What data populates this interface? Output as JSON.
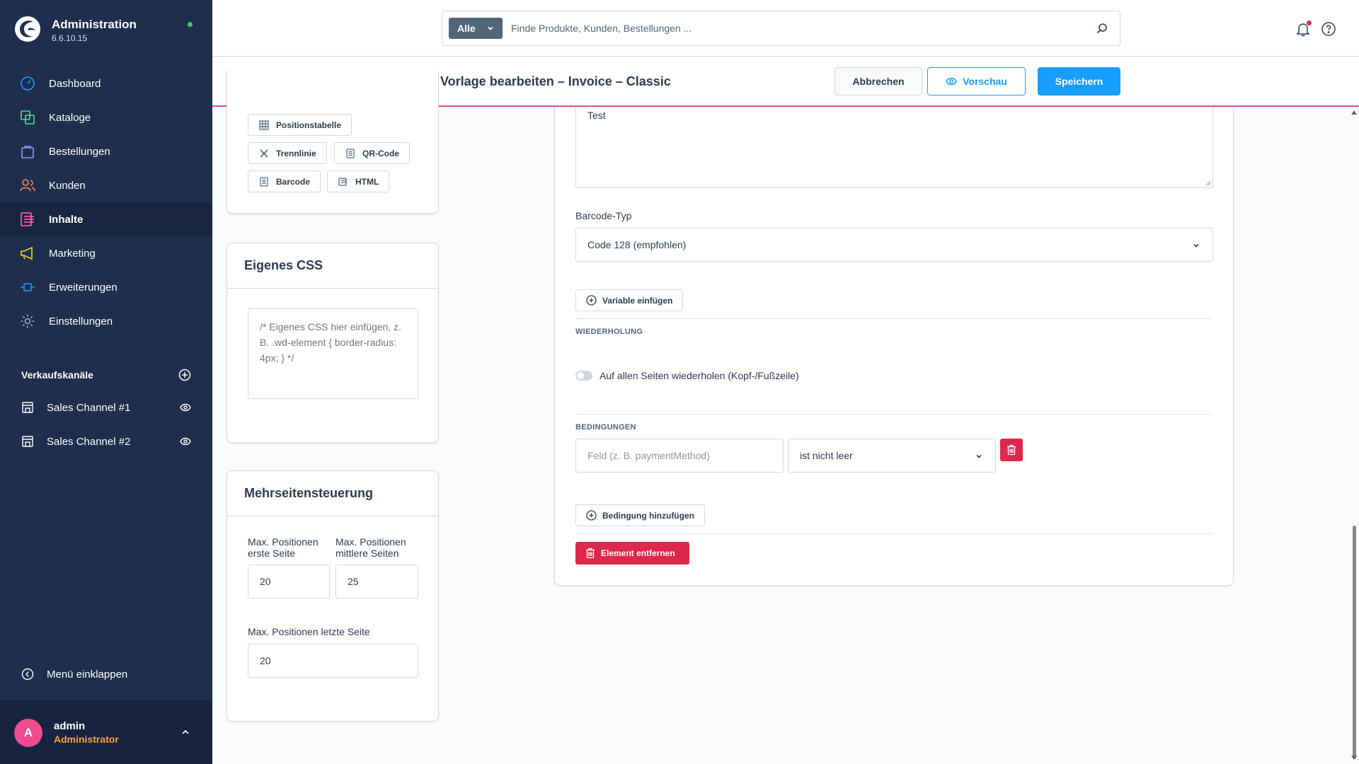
{
  "brand": {
    "title": "Administration",
    "version": "6.6.10.15"
  },
  "nav": [
    {
      "label": "Dashboard",
      "icon": "gauge-icon",
      "color": "#189eff"
    },
    {
      "label": "Kataloge",
      "icon": "products-icon",
      "color": "#57d9a3"
    },
    {
      "label": "Bestellungen",
      "icon": "shopping-bag-icon",
      "color": "#a092f0"
    },
    {
      "label": "Kunden",
      "icon": "users-icon",
      "color": "#f88962"
    },
    {
      "label": "Inhalte",
      "icon": "content-icon",
      "color": "#ff68b4"
    },
    {
      "label": "Marketing",
      "icon": "megaphone-icon",
      "color": "#ffd700"
    },
    {
      "label": "Erweiterungen",
      "icon": "plug-icon",
      "color": "#189eff"
    },
    {
      "label": "Einstellungen",
      "icon": "gear-icon",
      "color": "#9aa8b5"
    }
  ],
  "channels": {
    "heading": "Verkaufskanäle",
    "items": [
      {
        "label": "Sales Channel #1"
      },
      {
        "label": "Sales Channel #2"
      }
    ]
  },
  "collapse_label": "Menü einklappen",
  "user": {
    "initial": "A",
    "name": "admin",
    "role": "Administrator"
  },
  "search": {
    "scope": "Alle",
    "placeholder": "Finde Produkte, Kunden, Bestellungen ..."
  },
  "smartbar": {
    "title": "Vorlage bearbeiten – Invoice – Classic",
    "cancel": "Abbrechen",
    "preview": "Vorschau",
    "save": "Speichern"
  },
  "elements_card": {
    "chips": [
      "Positionstabelle",
      "Trennlinie",
      "QR-Code",
      "Barcode",
      "HTML"
    ]
  },
  "css_card": {
    "title": "Eigenes CSS",
    "placeholder": "/* Eigenes CSS hier einfügen, z. B. .wd-element { border-radius: 4px; } */"
  },
  "multipage_card": {
    "title": "Mehrseitensteuerung",
    "first_label_1": "Max. Positionen",
    "first_label_2": "erste Seite",
    "first_value": "20",
    "middle_label_1": "Max. Positionen",
    "middle_label_2": "mittlere Seiten",
    "middle_value": "25",
    "last_label": "Max. Positionen letzte Seite",
    "last_value": "20"
  },
  "element_editor": {
    "text_value": "Test",
    "barcode_label": "Barcode-Typ",
    "barcode_value": "Code 128 (empfohlen)",
    "insert_variable": "Variable einfügen",
    "repeat_heading": "WIEDERHOLUNG",
    "repeat_toggle": "Auf allen Seiten wiederholen (Kopf-/Fußzeile)",
    "conditions_heading": "BEDINGUNGEN",
    "condition_field_placeholder": "Feld (z. B. paymentMethod)",
    "condition_operator": "ist nicht leer",
    "add_condition": "Bedingung hinzufügen",
    "remove_element": "Element entfernen"
  },
  "colors": {
    "sidebar": "#1f2e4d",
    "primary": "#189eff",
    "danger": "#de294c",
    "accent": "#ee4c8e"
  }
}
